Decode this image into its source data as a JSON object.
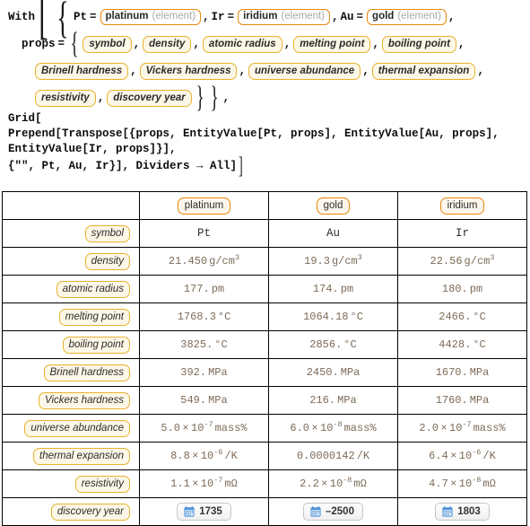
{
  "code": {
    "line1": {
      "kw_with": "With",
      "assign_pt": "Pt",
      "assign_ir": "Ir",
      "assign_au": "Au",
      "eq": "=",
      "comma": ",",
      "entity_pt": {
        "name": "platinum",
        "type": "(element)"
      },
      "entity_ir": {
        "name": "iridium",
        "type": "(element)"
      },
      "entity_au": {
        "name": "gold",
        "type": "(element)"
      }
    },
    "line2": {
      "props_var": "props",
      "eq": "=",
      "chips": [
        "symbol",
        "density",
        "atomic radius",
        "melting point",
        "boiling point"
      ]
    },
    "line3": {
      "chips": [
        "Brinell hardness",
        "Vickers hardness",
        "universe abundance",
        "thermal expansion"
      ]
    },
    "line4": {
      "chips": [
        "resistivity",
        "discovery year"
      ],
      "tail": "}},"
    },
    "grid_lines": [
      "Grid[",
      "  Prepend[Transpose[{props, EntityValue[Pt, props], EntityValue[Au, props],",
      "      EntityValue[Ir, props]}],",
      "   {\"\", Pt, Au, Ir}], Dividers → All]"
    ]
  },
  "table": {
    "corner": "",
    "headers": [
      "platinum",
      "gold",
      "iridium"
    ],
    "rows": [
      {
        "label": "symbol",
        "cells": [
          {
            "text": "Pt",
            "kind": "symbol"
          },
          {
            "text": "Au",
            "kind": "symbol"
          },
          {
            "text": "Ir",
            "kind": "symbol"
          }
        ]
      },
      {
        "label": "density",
        "cells": [
          {
            "mantissa": "21.450",
            "unit": "g/cm",
            "unit_sup": "3"
          },
          {
            "mantissa": "19.3",
            "unit": "g/cm",
            "unit_sup": "3"
          },
          {
            "mantissa": "22.56",
            "unit": "g/cm",
            "unit_sup": "3"
          }
        ]
      },
      {
        "label": "atomic radius",
        "cells": [
          {
            "mantissa": "177.",
            "unit": "pm"
          },
          {
            "mantissa": "174.",
            "unit": "pm"
          },
          {
            "mantissa": "180.",
            "unit": "pm"
          }
        ]
      },
      {
        "label": "melting point",
        "cells": [
          {
            "mantissa": "1768.3",
            "unit": "°C"
          },
          {
            "mantissa": "1064.18",
            "unit": "°C"
          },
          {
            "mantissa": "2466.",
            "unit": "°C"
          }
        ]
      },
      {
        "label": "boiling point",
        "cells": [
          {
            "mantissa": "3825.",
            "unit": "°C"
          },
          {
            "mantissa": "2856.",
            "unit": "°C"
          },
          {
            "mantissa": "4428.",
            "unit": "°C"
          }
        ]
      },
      {
        "label": "Brinell hardness",
        "cells": [
          {
            "mantissa": "392.",
            "unit": "MPa"
          },
          {
            "mantissa": "2450.",
            "unit": "MPa"
          },
          {
            "mantissa": "1670.",
            "unit": "MPa"
          }
        ]
      },
      {
        "label": "Vickers hardness",
        "cells": [
          {
            "mantissa": "549.",
            "unit": "MPa"
          },
          {
            "mantissa": "216.",
            "unit": "MPa"
          },
          {
            "mantissa": "1760.",
            "unit": "MPa"
          }
        ]
      },
      {
        "label": "universe abundance",
        "cells": [
          {
            "mantissa": "5.0",
            "times": "×",
            "base": "10",
            "exp": "-7",
            "unit": "mass%"
          },
          {
            "mantissa": "6.0",
            "times": "×",
            "base": "10",
            "exp": "-8",
            "unit": "mass%"
          },
          {
            "mantissa": "2.0",
            "times": "×",
            "base": "10",
            "exp": "-7",
            "unit": "mass%"
          }
        ]
      },
      {
        "label": "thermal expansion",
        "cells": [
          {
            "mantissa": "8.8",
            "times": "×",
            "base": "10",
            "exp": "-6",
            "unit": "/K"
          },
          {
            "mantissa": "0.0000142",
            "unit": "/K"
          },
          {
            "mantissa": "6.4",
            "times": "×",
            "base": "10",
            "exp": "-6",
            "unit": "/K"
          }
        ]
      },
      {
        "label": "resistivity",
        "cells": [
          {
            "mantissa": "1.1",
            "times": "×",
            "base": "10",
            "exp": "-7",
            "unit": "mΩ"
          },
          {
            "mantissa": "2.2",
            "times": "×",
            "base": "10",
            "exp": "-8",
            "unit": "mΩ"
          },
          {
            "mantissa": "4.7",
            "times": "×",
            "base": "10",
            "exp": "-8",
            "unit": "mΩ"
          }
        ]
      },
      {
        "label": "discovery year",
        "cells": [
          {
            "date": "1735",
            "icon": "calendar-icon"
          },
          {
            "date": "–2500",
            "icon": "calendar-icon"
          },
          {
            "date": "1803",
            "icon": "calendar-icon"
          }
        ]
      }
    ]
  },
  "colors": {
    "entity_border": "#e8870c",
    "property_border": "#e8b22e",
    "property_bg": "#fdf7e7",
    "value_text": "#7d6b58",
    "calendar_icon": "#4a90d9"
  }
}
